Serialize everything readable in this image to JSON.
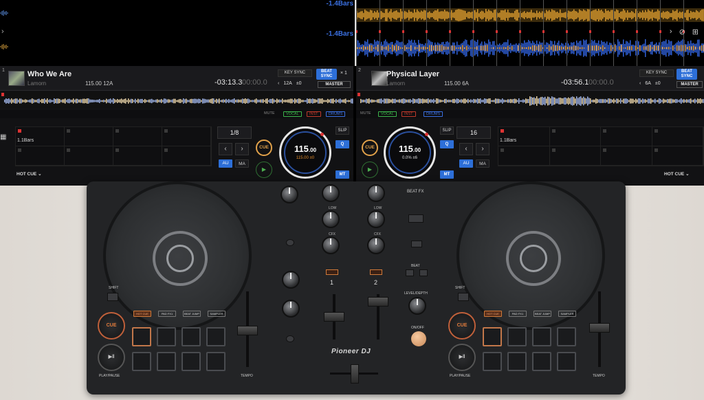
{
  "waveform": {
    "left_bars": "-1.4Bars",
    "right_bars": "-1.4Bars"
  },
  "deck1": {
    "number": "1",
    "title": "Who We Are",
    "artist": "Lamorn",
    "bpm_key": "115.00  12A",
    "remaining": "-03:13.3",
    "elapsed": "00:00.0",
    "key_sync": "KEY SYNC",
    "beat_sync": "BEAT SYNC",
    "multiplier": "× 1",
    "key": "12A",
    "key_offset": "±0",
    "master": "MASTER",
    "mute": "MUTE",
    "stems": [
      "VOCAL",
      "INST",
      "DRUMS"
    ],
    "hotcue_label": "1.1Bars",
    "hotcue_mode": "HOT CUE",
    "beat_jump": "1/8",
    "au": "AU",
    "ma": "MA",
    "cue": "CUE",
    "jog_bpm": "115",
    "jog_bpm_dec": ".00",
    "jog_pitch": "115.00  ±0",
    "slip": "SLIP",
    "q": "Q",
    "mt": "MT"
  },
  "deck2": {
    "number": "2",
    "title": "Physical Layer",
    "artist": "Lamorn",
    "bpm_key": "115.00  6A",
    "remaining": "-03:56.1",
    "elapsed": "00:00.0",
    "key_sync": "KEY SYNC",
    "beat_sync": "BEAT SYNC",
    "key": "6A",
    "key_offset": "±0",
    "master": "MASTER",
    "mute": "MUTE",
    "stems": [
      "VOCAL",
      "INST",
      "DRUMS"
    ],
    "hotcue_label": "1.1Bars",
    "hotcue_mode": "HOT CUE",
    "beat_jump": "16",
    "au": "AU",
    "ma": "MA",
    "cue": "CUE",
    "jog_bpm": "115",
    "jog_bpm_dec": ".00",
    "jog_pitch": "0.0%  ±6",
    "slip": "SLIP",
    "q": "Q",
    "mt": "MT"
  },
  "hardware": {
    "brand": "Pioneer DJ",
    "beat_fx": "BEAT FX",
    "channel_1": "1",
    "channel_2": "2",
    "cue_left": "CUE",
    "cue_right": "CUE",
    "play_pause": "PLAY/PAUSE",
    "tempo": "TEMPO",
    "shift": "SHIFT",
    "low": "LOW",
    "cfx": "CFX",
    "level_depth": "LEVEL/DEPTH",
    "on_off": "ON/OFF",
    "beat": "BEAT",
    "pad_modes": [
      "HOT CUE",
      "PAD FX1",
      "BEAT JUMP",
      "SAMPLER"
    ],
    "colors": {
      "accent_blue": "#2d6fd8",
      "cue_orange": "#e2a24a",
      "play_green": "#4caf50",
      "stem_vocal": "#3cb44b",
      "stem_inst": "#c0392b",
      "stem_drums": "#3a6fe0"
    }
  }
}
